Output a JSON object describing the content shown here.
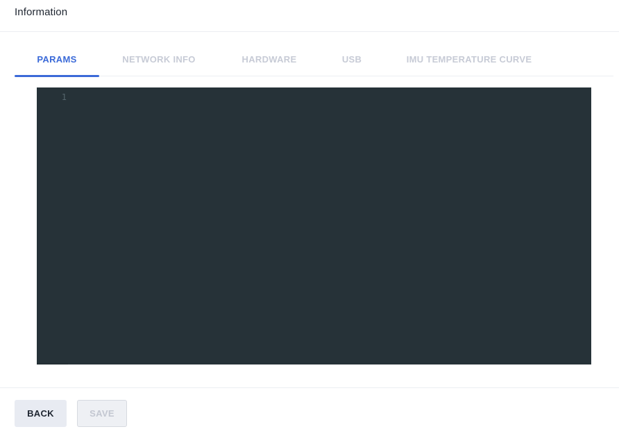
{
  "header": {
    "title": "Information"
  },
  "tabs": [
    {
      "label": "PARAMS",
      "active": true
    },
    {
      "label": "NETWORK INFO",
      "active": false
    },
    {
      "label": "HARDWARE",
      "active": false
    },
    {
      "label": "USB",
      "active": false
    },
    {
      "label": "IMU TEMPERATURE CURVE",
      "active": false
    }
  ],
  "editor": {
    "line_numbers": [
      "1"
    ],
    "content": "",
    "background_color": "#263238"
  },
  "footer": {
    "back_label": "BACK",
    "save_label": "SAVE",
    "save_disabled": true
  },
  "colors": {
    "accent": "#3b6ad8",
    "tab_inactive": "#c7cbd6"
  }
}
